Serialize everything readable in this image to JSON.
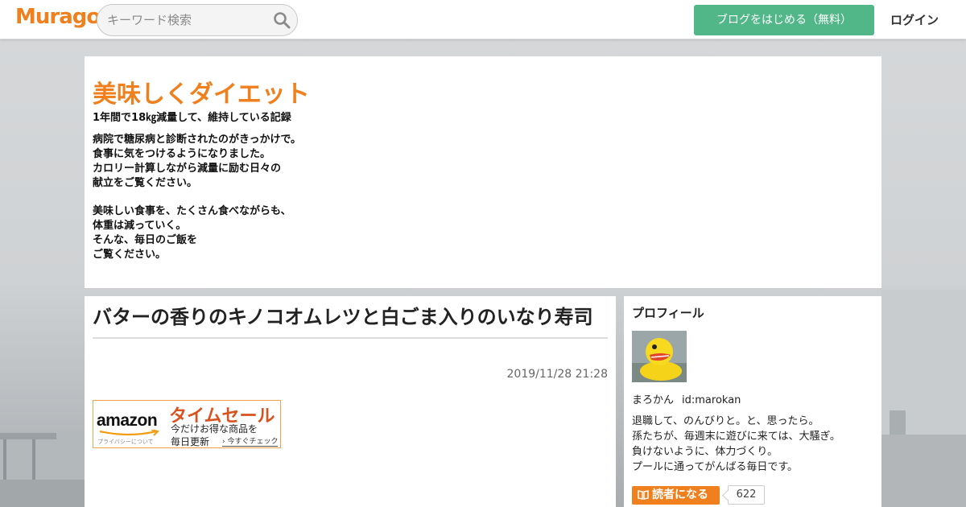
{
  "header": {
    "logo": "Muragon",
    "search_placeholder": "キーワード検索",
    "start_blog_label": "ブログをはじめる（無料）",
    "login_label": "ログイン"
  },
  "blog": {
    "title": "美味しくダイエット",
    "tagline": "1年間で18㎏減量して、維持している記録",
    "description": [
      "病院で糖尿病と診断されたのがきっかけで。\n食事に気をつけるようになりました。\nカロリー計算しながら減量に励む日々の\n献立をご覧ください。",
      "美味しい食事を、たくさん食べながらも、\n体重は減っていく。\nそんな、毎日のご飯を\nご覧ください。"
    ]
  },
  "article": {
    "title": "バターの香りのキノコオムレツと白ごま入りのいなり寿司",
    "date": "2019/11/28 21:28"
  },
  "ad": {
    "brand": "amazon",
    "privacy": "プライバシーについて",
    "headline": "タイムセール",
    "line1": "今だけお得な商品を",
    "line2": "毎日更新",
    "cta": "今すぐチェック"
  },
  "profile": {
    "heading": "プロフィール",
    "name": "まろかん",
    "user_id": "id:marokan",
    "bio": "退職して、のんびりと。と、思ったら。\n孫たちが、毎週末に遊びに来ては、大騒ぎ。\n負けないように、体力づくり。\nプールに通ってがんばる毎日です。",
    "follow_label": "読者になる",
    "follower_count": "622"
  },
  "colors": {
    "brand_orange": "#f07f1d",
    "start_green": "#52b788",
    "ad_red": "#d9531e"
  }
}
